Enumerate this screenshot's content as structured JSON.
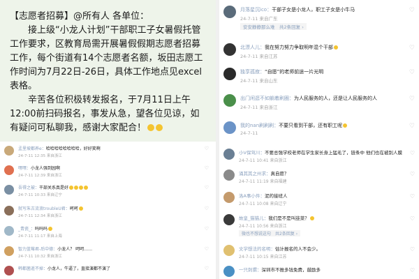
{
  "announcement": {
    "lines": [
      "【志愿者招募】@所有人 各单位：",
      "　　接上级“小龙人计划”干部职工子女暑假托管工作要求，区教育局需开展暑假假期志愿者招募工作，每个街道有14个志愿者名额，坂田志愿工作时间为7月22日-26日，具体工作地点见excel表格。",
      "　　辛苦各位积极转发报名，于7月11日上午12:00前扫码报名，事发从急，望各位见谅，如有疑问可私聊我，感谢大家配合！"
    ]
  },
  "top_right": [
    {
      "name": "月落星沉ico",
      "text": "干部子女是小龙人，职工子女是小牛马",
      "date": "24-7-11",
      "loc": "来自广东",
      "likes": "",
      "replies": "",
      "color": "#5a6b7a"
    },
    {
      "name": "安安静静那么难",
      "text": "",
      "date": "",
      "loc": "",
      "likes": "",
      "replies": "",
      "color": "#e08b8b"
    },
    {
      "name": "北漂人儿",
      "text": "我在努力努力争取明年混个干部",
      "date": "24-7-11",
      "loc": "来自江苏",
      "likes": "",
      "replies": "",
      "color": "#333"
    },
    {
      "name": "独享孤寂",
      "text": "“自愿”的老师前途一片光明",
      "date": "24-7-11",
      "loc": "来自山东",
      "likes": "",
      "replies": "",
      "color": "#2a2a2a"
    },
    {
      "name": "出门闲逛不如躺着刷圈",
      "text": "为人民服务的人，还是让人民服务的人",
      "date": "24-7-11",
      "loc": "来自浙江",
      "likes": "",
      "replies": "",
      "color": "#4a8f4a"
    },
    {
      "name": "我的nan刷刷刷",
      "text": "不要只看到干部，还有职工呢",
      "date": "24-7-11",
      "loc": "",
      "likes": "",
      "replies": "",
      "color": "#6b93c7"
    }
  ],
  "top_right_reply": {
    "user": "安安静静那么难",
    "count": "共2条回复"
  },
  "bottom_left": [
    {
      "name": "孟里坡都养e",
      "text": "哈哈哈哈哈哈哈哈，好好笑啊",
      "date": "24-7-11 12:35",
      "loc": "来自浙江",
      "likes": "",
      "color": "#c9a97a"
    },
    {
      "name": "嘿嘿",
      "text": "小龙人强到园啊",
      "date": "24-7-11 12:39",
      "loc": "来自浙江",
      "likes": "",
      "color": "#e07050"
    },
    {
      "name": "吾得之被",
      "text": "干部关系真是好",
      "date": "24-7-11 10:33",
      "loc": "来自辽宁",
      "likes": "",
      "color": "#7a8fa3"
    },
    {
      "name": "就写朱古流浪troubleU君",
      "text": "呵呵",
      "date": "24-7-11 12:34",
      "loc": "来自浙江",
      "likes": "",
      "color": "#8a6f5a"
    },
    {
      "name": "_青瓷_",
      "text": "吗吗吗",
      "date": "24-7-11 11:17",
      "loc": "来自上海",
      "likes": "",
      "color": "#a0b8c8"
    },
    {
      "name": "智力蓝莓君-后中德",
      "text": "小龙人？ 呵呵……",
      "date": "24-7-11 10:32",
      "loc": "来自浙江",
      "likes": "",
      "color": "#d0a060"
    },
    {
      "name": "韩都菌遥不掉",
      "text": "小龙人，牛逼了，直接演都不演了",
      "date": "24-7-11",
      "loc": "",
      "likes": "",
      "color": "#b05050"
    }
  ],
  "bottom_right": [
    {
      "name": "小V保驾川",
      "text": "不要总强学校老师在学生家长身上猛毛了，链条中 他们也在被别人膜",
      "date": "24-7-11 10:41",
      "loc": "来自浙江",
      "likes": "",
      "color": "#6a7f94"
    },
    {
      "name": "涌其其之州求",
      "text": "真自愿？",
      "date": "24-7-11 11:19",
      "loc": "来自福建",
      "likes": "",
      "color": "#8a8a8a"
    },
    {
      "name": "洛A事小件",
      "text": "泥的接班人",
      "date": "24-7-11 10:08",
      "loc": "来自辽宁",
      "likes": "",
      "color": "#c49a6c"
    },
    {
      "name": "故皇_猫猫儿",
      "text": "我们是不是叫韭菜？",
      "date": "24-7-11 10:56",
      "loc": "来自浙江",
      "likes": "",
      "color": "#3a3a3a"
    },
    {
      "name": "文学想法的名明",
      "text": "估计报名的人不会少。",
      "date": "24-7-11 10:15",
      "loc": "来自江苏",
      "likes": "",
      "color": "#e0c070"
    },
    {
      "name": "一只刺猬",
      "text": "深圳市不推多钱免费，鼓励多",
      "date": "24-7-11",
      "loc": "",
      "likes": "",
      "color": "#4a90c4"
    }
  ],
  "bottom_right_reply": {
    "user": "微也不想说这句",
    "count": "共2条回复"
  },
  "colors": {
    "accent_link": "#8aa0be",
    "announce_bg": "#eef4ea",
    "meta": "#a5a5a5"
  }
}
